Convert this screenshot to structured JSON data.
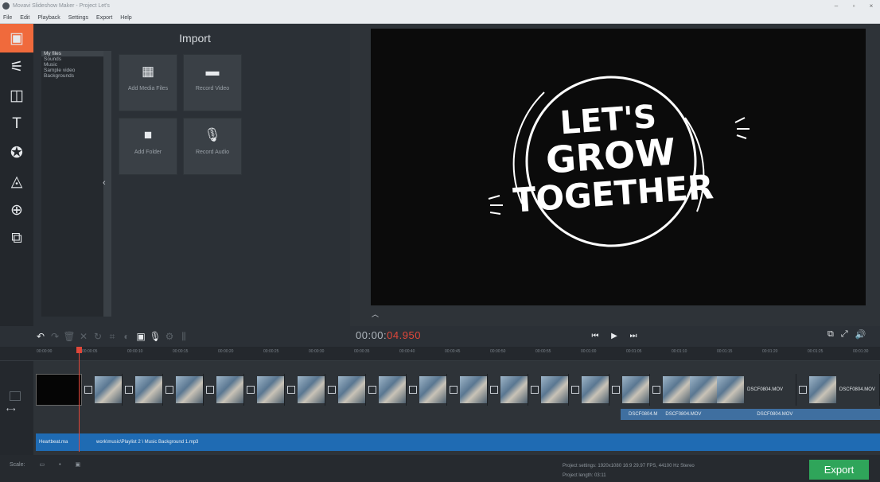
{
  "titlebar": {
    "title": "Movavi Slideshow Maker - Project Let's",
    "min": "–",
    "max": "▫",
    "close": "×"
  },
  "menu": [
    "File",
    "Edit",
    "Playback",
    "Settings",
    "Export",
    "Help"
  ],
  "import": {
    "title": "Import",
    "folders": [
      "My files",
      "Sounds",
      "Music",
      "Sample video",
      "Backgrounds"
    ],
    "tiles": [
      {
        "label": "Add Media Files",
        "icon": "add-media-icon"
      },
      {
        "label": "Record Video",
        "icon": "camera-icon"
      },
      {
        "label": "Add Folder",
        "icon": "folder-icon"
      },
      {
        "label": "Record Audio",
        "icon": "microphone-icon"
      }
    ]
  },
  "preview": {
    "line1": "LET'S",
    "line2": "GROW",
    "line3": "TOGETHER"
  },
  "timecode": {
    "main": "00:00:",
    "highlight": "04.950"
  },
  "ruler": [
    "00:00:00",
    "00:00:05",
    "00:00:10",
    "00:00:15",
    "00:00:20",
    "00:00:25",
    "00:00:30",
    "00:00:35",
    "00:00:40",
    "00:00:45",
    "00:00:50",
    "00:00:55",
    "00:01:00",
    "00:01:05",
    "00:01:10",
    "00:01:15",
    "00:01:20",
    "00:01:25",
    "00:01:30"
  ],
  "clips": {
    "c1": "DSCF0804.MOV",
    "c2": "DSCF0804.MOV"
  },
  "audio_clips": {
    "a1": "DSCF0804.M",
    "a2": "DSCF0804.MOV",
    "a3": "DSCF0804.MOV"
  },
  "music": {
    "m1": "Heartbeat.ma",
    "m2": "work\\music\\Playlist 2 \\ Music Background 1.mp3"
  },
  "footer": {
    "scale_label": "Scale:",
    "project_settings": "Project settings: 1920x1080 16:9 29.97 FPS, 44100 Hz Stereo",
    "project_length": "Project length: 03:11",
    "export_label": "Export"
  },
  "colors": {
    "accent": "#f06a3c",
    "export": "#2fa55a",
    "music": "#1f6bb3",
    "playhead": "#e0473a"
  }
}
